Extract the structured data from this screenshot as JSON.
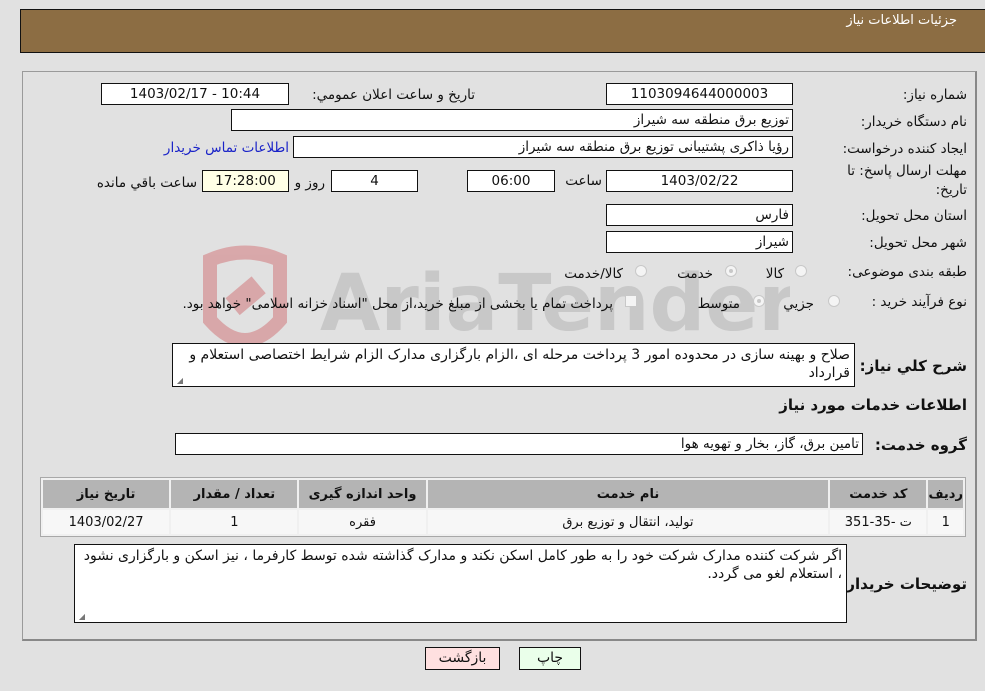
{
  "header": {
    "title": "جزئیات اطلاعات نیاز"
  },
  "form": {
    "need_number": {
      "label": "شماره نیاز:",
      "value": "1103094644000003"
    },
    "announce_datetime": {
      "label": "تاریخ و ساعت اعلان عمومي:",
      "value": "1403/02/17 - 10:44"
    },
    "buyer_org": {
      "label": "نام دستگاه خریدار:",
      "value": "توزیع برق منطقه سه شیراز"
    },
    "requester": {
      "label": "ایجاد کننده درخواست:",
      "value": "رؤیا ذاکری پشتیبانی توزیع برق منطقه سه شیراز"
    },
    "buyer_contact_link": "اطلاعات تماس خریدار",
    "deadline": {
      "label_line1": "مهلت ارسال پاسخ: تا",
      "label_line2": "تاریخ:",
      "date": "1403/02/22",
      "time_label": "ساعت",
      "time": "06:00",
      "days": "4",
      "days_label": "روز و",
      "remaining_time": "17:28:00",
      "remaining_label": "ساعت باقي مانده"
    },
    "province": {
      "label": "استان محل تحویل:",
      "value": "فارس"
    },
    "city": {
      "label": "شهر محل تحویل:",
      "value": "شیراز"
    },
    "category": {
      "label": "طبقه بندی موضوعی:",
      "options": [
        "کالا",
        "خدمت",
        "کالا/خدمت"
      ],
      "selected": "خدمت"
    },
    "purchase_type": {
      "label": "نوع فرآیند خرید :",
      "options": [
        "جزيي",
        "متوسط"
      ],
      "selected": "متوسط",
      "treasury_checkbox_label": "پرداخت تمام یا بخشی از مبلغ خرید،از محل \"اسناد خزانه اسلامی\" خواهد بود."
    },
    "description": {
      "label": "شرح کلي نیاز:",
      "value": "صلاح و بهینه سازی در محدوده امور 3 پرداخت مرحله ای ،الزام بارگزاری مدارک الزام شرایط اختصاصی استعلام و قرارداد"
    }
  },
  "services": {
    "section_title": "اطلاعات خدمات مورد نیاز",
    "group": {
      "label": "گروه خدمت:",
      "value": "تامین برق، گاز، بخار و تهویه هوا"
    },
    "table": {
      "headers": [
        "ردیف",
        "کد خدمت",
        "نام خدمت",
        "واحد اندازه گیری",
        "تعداد / مقدار",
        "تاریخ نیاز"
      ],
      "rows": [
        [
          "1",
          "ت -35-351",
          "تولید، انتقال و توزیع برق",
          "فقره",
          "1",
          "1403/02/27"
        ]
      ]
    }
  },
  "buyer_notes": {
    "label": "توضیحات خریدار:",
    "value": "اگر شرکت کننده مدارک شرکت خود را به طور کامل اسکن نکند و مدارک گذاشته شده توسط کارفرما ، نیز اسکن و بارگزاری نشود ، استعلام لغو می گردد."
  },
  "buttons": {
    "print": {
      "label": "چاپ",
      "color": "#eaffea"
    },
    "back": {
      "label": "بازگشت",
      "color": "#ffe0e0"
    }
  },
  "watermark": {
    "text": "AriaTender.neT"
  }
}
